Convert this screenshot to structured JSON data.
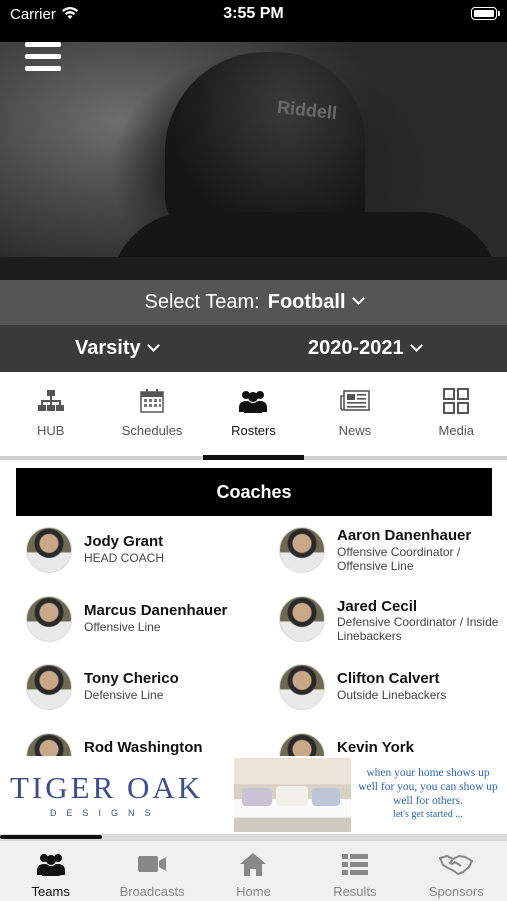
{
  "status_bar": {
    "carrier": "Carrier",
    "time": "3:55 PM"
  },
  "hero": {
    "helmet_text": "Riddell"
  },
  "team_select": {
    "label": "Select Team:",
    "value": "Football"
  },
  "filters": {
    "level": "Varsity",
    "season": "2020-2021"
  },
  "tabs": [
    {
      "label": "HUB",
      "icon": "org-chart-icon"
    },
    {
      "label": "Schedules",
      "icon": "calendar-icon"
    },
    {
      "label": "Rosters",
      "icon": "people-group-icon",
      "active": true
    },
    {
      "label": "News",
      "icon": "newspaper-icon"
    },
    {
      "label": "Media",
      "icon": "grid-icon"
    }
  ],
  "coaches_section": {
    "title": "Coaches"
  },
  "coaches": [
    {
      "name": "Jody Grant",
      "title": "HEAD COACH"
    },
    {
      "name": "Aaron Danenhauer",
      "title": "Offensive Coordinator / Offensive Line"
    },
    {
      "name": "Marcus Danenhauer",
      "title": "Offensive Line"
    },
    {
      "name": "Jared Cecil",
      "title": "Defensive Coordinator / Inside Linebackers"
    },
    {
      "name": "Tony Cherico",
      "title": "Defensive Line"
    },
    {
      "name": "Clifton Calvert",
      "title": "Outside Linebackers"
    },
    {
      "name": "Rod Washington",
      "title": ""
    },
    {
      "name": "Kevin York",
      "title": ""
    }
  ],
  "ad": {
    "brand": "TIGER OAK",
    "brand_sub": "DESIGNS",
    "copy": "when your home shows up well for you, you can show up well for others.",
    "cta": "let's get started ..."
  },
  "bottom_nav": [
    {
      "label": "Teams",
      "icon": "people-group-icon",
      "active": true
    },
    {
      "label": "Broadcasts",
      "icon": "video-camera-icon"
    },
    {
      "label": "Home",
      "icon": "home-icon"
    },
    {
      "label": "Results",
      "icon": "list-icon"
    },
    {
      "label": "Sponsors",
      "icon": "handshake-icon"
    }
  ],
  "colors": {
    "header_gray": "#555555",
    "filter_dark": "#3a3a3a",
    "black": "#000000",
    "ad_blue": "#3d4f8a"
  }
}
